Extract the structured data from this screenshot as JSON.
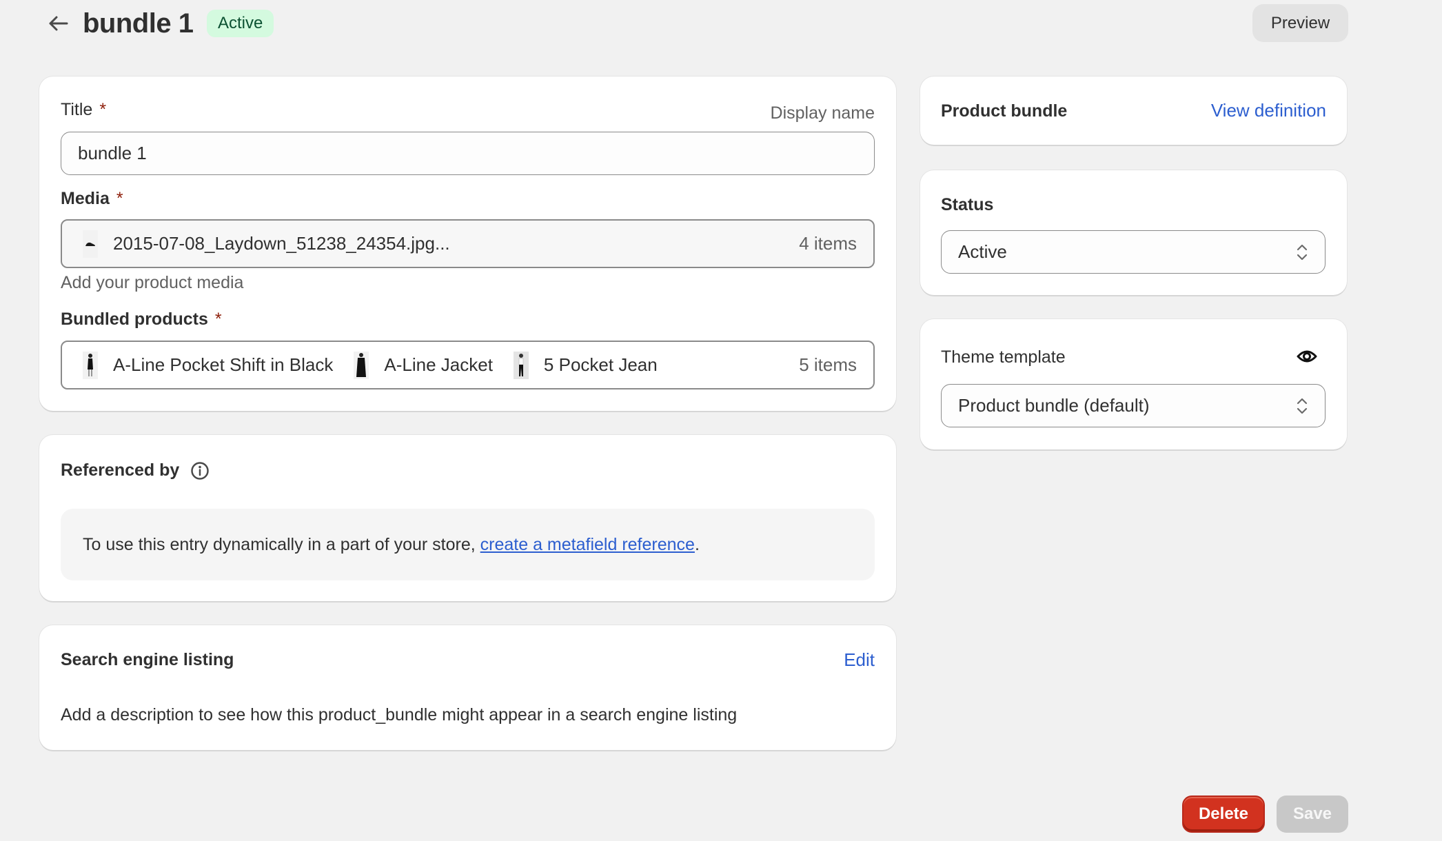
{
  "header": {
    "title": "bundle 1",
    "status_badge": "Active",
    "preview_label": "Preview",
    "badge_color": "#d4fadf"
  },
  "main_card": {
    "title_field": {
      "label": "Title",
      "required_mark": "*",
      "hint": "Display name",
      "value": "bundle 1"
    },
    "media_field": {
      "label": "Media",
      "required_mark": "*",
      "file_name": "2015-07-08_Laydown_51238_24354.jpg...",
      "count": "4 items",
      "help_text": "Add your product media"
    },
    "bundled_products": {
      "label": "Bundled products",
      "required_mark": "*",
      "items": [
        {
          "name": "A-Line Pocket Shift in Black"
        },
        {
          "name": "A-Line Jacket"
        },
        {
          "name": "5 Pocket Jean"
        }
      ],
      "count": "5 items"
    }
  },
  "referenced_by": {
    "heading": "Referenced by",
    "message_prefix": "To use this entry dynamically in a part of your store, ",
    "link_text": "create a metafield reference",
    "message_suffix": "."
  },
  "search_engine": {
    "heading": "Search engine listing",
    "edit_label": "Edit",
    "description": "Add a description to see how this product_bundle might appear in a search engine listing"
  },
  "sidebar": {
    "definition_card": {
      "heading": "Product bundle",
      "link_label": "View definition"
    },
    "status_card": {
      "heading": "Status",
      "selected": "Active"
    },
    "theme_card": {
      "heading": "Theme template",
      "selected": "Product bundle (default)"
    }
  },
  "footer": {
    "delete_label": "Delete",
    "save_label": "Save",
    "delete_color": "#d2321f"
  },
  "colors": {
    "link": "#2c5ecf",
    "required": "#8e1f0b",
    "background": "#f1f1f1"
  }
}
